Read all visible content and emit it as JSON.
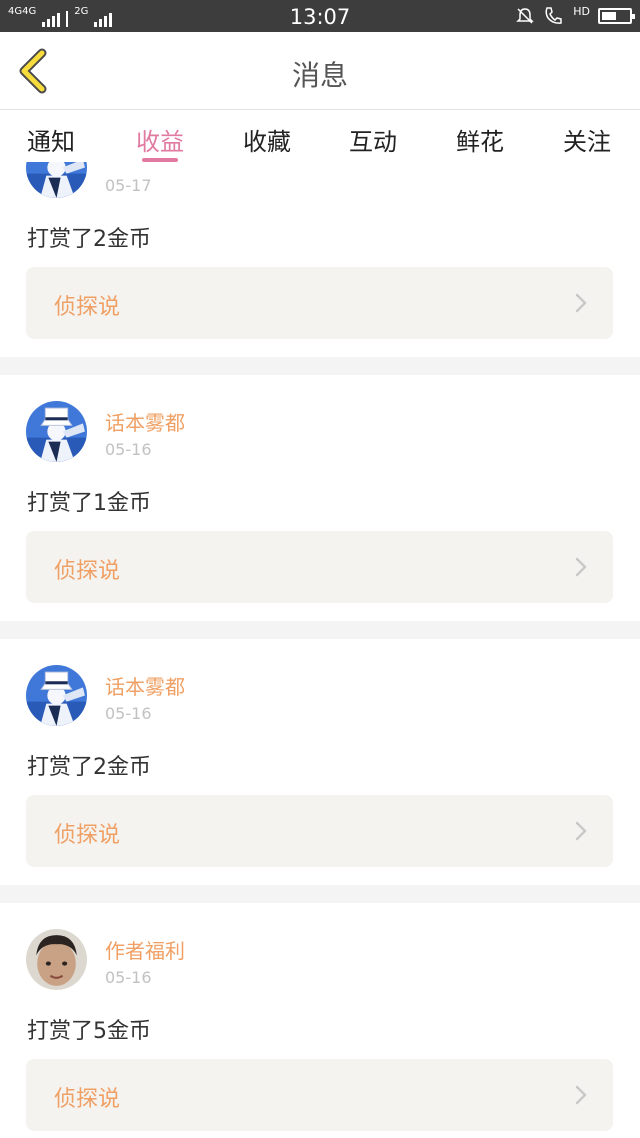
{
  "status_bar": {
    "network_left": "4G4G",
    "network_right": "2G",
    "time": "13:07",
    "call_badge": "HD",
    "battery_level": 0.52
  },
  "header": {
    "title": "消息",
    "back_icon": "chevron-left-icon"
  },
  "tabs": [
    {
      "label": "通知",
      "active": false
    },
    {
      "label": "收益",
      "active": true
    },
    {
      "label": "收藏",
      "active": false
    },
    {
      "label": "互动",
      "active": false
    },
    {
      "label": "鲜花",
      "active": false
    },
    {
      "label": "关注",
      "active": false
    }
  ],
  "colors": {
    "accent_pink": "#e07aa0",
    "accent_orange": "#f0a064",
    "card_source_bg": "#f4f3ef"
  },
  "items": [
    {
      "username": "",
      "date": "05-17",
      "action": "打赏了2金币",
      "source": "侦探说",
      "avatar": "kid-avatar"
    },
    {
      "username": "话本雾都",
      "date": "05-16",
      "action": "打赏了1金币",
      "source": "侦探说",
      "avatar": "kid-avatar"
    },
    {
      "username": "话本雾都",
      "date": "05-16",
      "action": "打赏了2金币",
      "source": "侦探说",
      "avatar": "kid-avatar"
    },
    {
      "username": "作者福利",
      "date": "05-16",
      "action": "打赏了5金币",
      "source": "侦探说",
      "avatar": "child-photo-avatar"
    }
  ]
}
